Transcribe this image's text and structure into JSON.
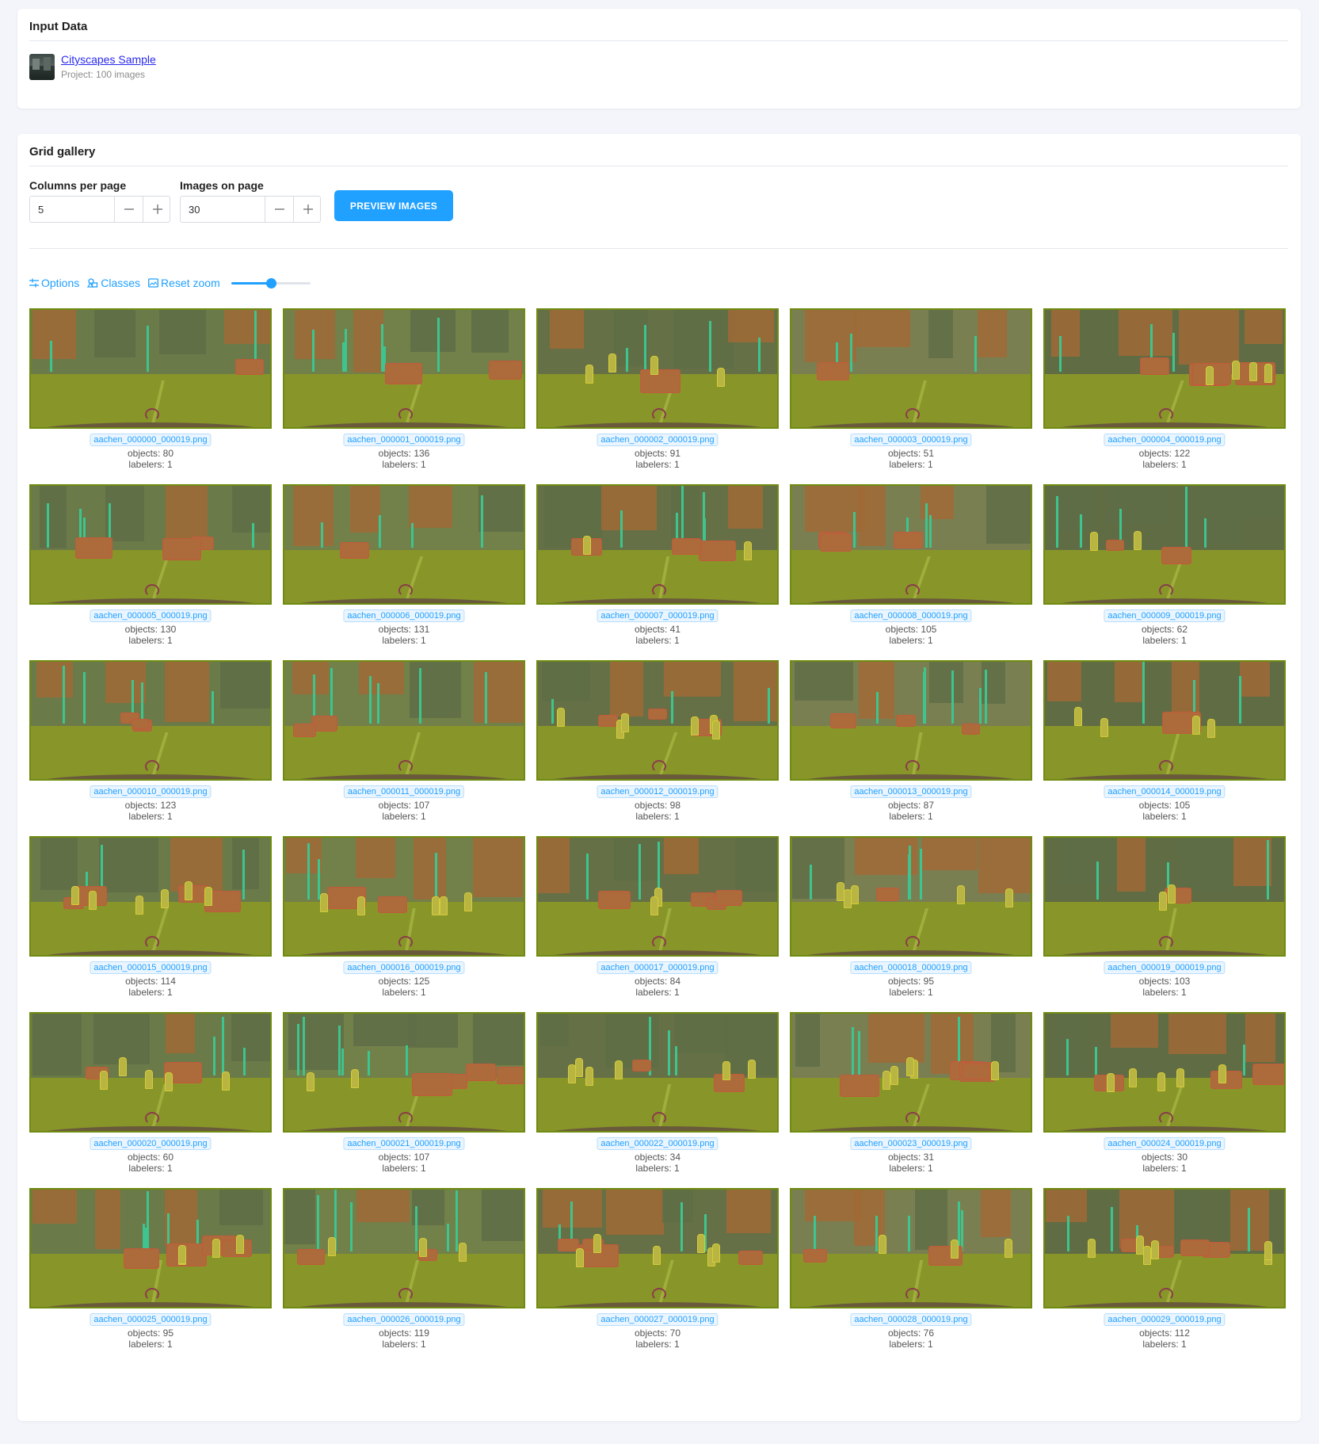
{
  "input_card": {
    "title": "Input Data",
    "project_name": "Cityscapes Sample",
    "project_meta": "Project: 100 images"
  },
  "gallery_card": {
    "title": "Grid gallery",
    "columns_label": "Columns per page",
    "columns_value": "5",
    "images_label": "Images on page",
    "images_value": "30",
    "preview_button": "PREVIEW IMAGES",
    "toolbar": {
      "options": "Options",
      "classes": "Classes",
      "reset_zoom": "Reset zoom",
      "zoom_level": 0.5
    }
  },
  "colors": {
    "accent": "#20a0ff",
    "overlay_road": "#889529",
    "overlay_vehicle": "#c25a3c",
    "overlay_pole": "#3ec48e",
    "overlay_person": "#d5cc3a",
    "border": "#6f8b10"
  },
  "images": [
    {
      "name": "aachen_000000_000019.png",
      "objects": "objects: 80",
      "labelers": "labelers: 1"
    },
    {
      "name": "aachen_000001_000019.png",
      "objects": "objects: 136",
      "labelers": "labelers: 1"
    },
    {
      "name": "aachen_000002_000019.png",
      "objects": "objects: 91",
      "labelers": "labelers: 1"
    },
    {
      "name": "aachen_000003_000019.png",
      "objects": "objects: 51",
      "labelers": "labelers: 1"
    },
    {
      "name": "aachen_000004_000019.png",
      "objects": "objects: 122",
      "labelers": "labelers: 1"
    },
    {
      "name": "aachen_000005_000019.png",
      "objects": "objects: 130",
      "labelers": "labelers: 1"
    },
    {
      "name": "aachen_000006_000019.png",
      "objects": "objects: 131",
      "labelers": "labelers: 1"
    },
    {
      "name": "aachen_000007_000019.png",
      "objects": "objects: 41",
      "labelers": "labelers: 1"
    },
    {
      "name": "aachen_000008_000019.png",
      "objects": "objects: 105",
      "labelers": "labelers: 1"
    },
    {
      "name": "aachen_000009_000019.png",
      "objects": "objects: 62",
      "labelers": "labelers: 1"
    },
    {
      "name": "aachen_000010_000019.png",
      "objects": "objects: 123",
      "labelers": "labelers: 1"
    },
    {
      "name": "aachen_000011_000019.png",
      "objects": "objects: 107",
      "labelers": "labelers: 1"
    },
    {
      "name": "aachen_000012_000019.png",
      "objects": "objects: 98",
      "labelers": "labelers: 1"
    },
    {
      "name": "aachen_000013_000019.png",
      "objects": "objects: 87",
      "labelers": "labelers: 1"
    },
    {
      "name": "aachen_000014_000019.png",
      "objects": "objects: 105",
      "labelers": "labelers: 1"
    },
    {
      "name": "aachen_000015_000019.png",
      "objects": "objects: 114",
      "labelers": "labelers: 1"
    },
    {
      "name": "aachen_000016_000019.png",
      "objects": "objects: 125",
      "labelers": "labelers: 1"
    },
    {
      "name": "aachen_000017_000019.png",
      "objects": "objects: 84",
      "labelers": "labelers: 1"
    },
    {
      "name": "aachen_000018_000019.png",
      "objects": "objects: 95",
      "labelers": "labelers: 1"
    },
    {
      "name": "aachen_000019_000019.png",
      "objects": "objects: 103",
      "labelers": "labelers: 1"
    },
    {
      "name": "aachen_000020_000019.png",
      "objects": "objects: 60",
      "labelers": "labelers: 1"
    },
    {
      "name": "aachen_000021_000019.png",
      "objects": "objects: 107",
      "labelers": "labelers: 1"
    },
    {
      "name": "aachen_000022_000019.png",
      "objects": "objects: 34",
      "labelers": "labelers: 1"
    },
    {
      "name": "aachen_000023_000019.png",
      "objects": "objects: 31",
      "labelers": "labelers: 1"
    },
    {
      "name": "aachen_000024_000019.png",
      "objects": "objects: 30",
      "labelers": "labelers: 1"
    },
    {
      "name": "aachen_000025_000019.png",
      "objects": "objects: 95",
      "labelers": "labelers: 1"
    },
    {
      "name": "aachen_000026_000019.png",
      "objects": "objects: 119",
      "labelers": "labelers: 1"
    },
    {
      "name": "aachen_000027_000019.png",
      "objects": "objects: 70",
      "labelers": "labelers: 1"
    },
    {
      "name": "aachen_000028_000019.png",
      "objects": "objects: 76",
      "labelers": "labelers: 1"
    },
    {
      "name": "aachen_000029_000019.png",
      "objects": "objects: 112",
      "labelers": "labelers: 1"
    }
  ]
}
